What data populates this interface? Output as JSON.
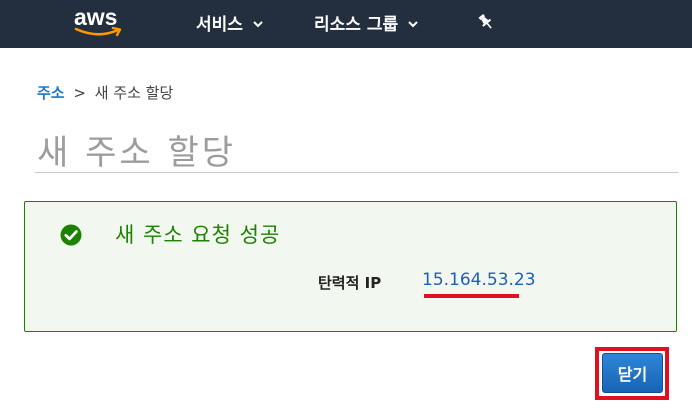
{
  "header": {
    "logo_text": "aws",
    "nav": [
      {
        "label": "서비스"
      },
      {
        "label": "리소스 그룹"
      }
    ]
  },
  "breadcrumb": {
    "link": "주소",
    "separator": ">",
    "current": "새 주소 할당"
  },
  "page": {
    "title": "새 주소 할당"
  },
  "result": {
    "message": "새 주소 요청 성공",
    "eip_label": "탄력적 IP",
    "eip_value": "15.164.53.23"
  },
  "actions": {
    "close_label": "닫기"
  },
  "colors": {
    "header_bg": "#232f3e",
    "success_green": "#1d8102",
    "link_blue": "#1f77c8",
    "button_blue": "#1f6fc5",
    "annotation_red": "#e0101f"
  }
}
